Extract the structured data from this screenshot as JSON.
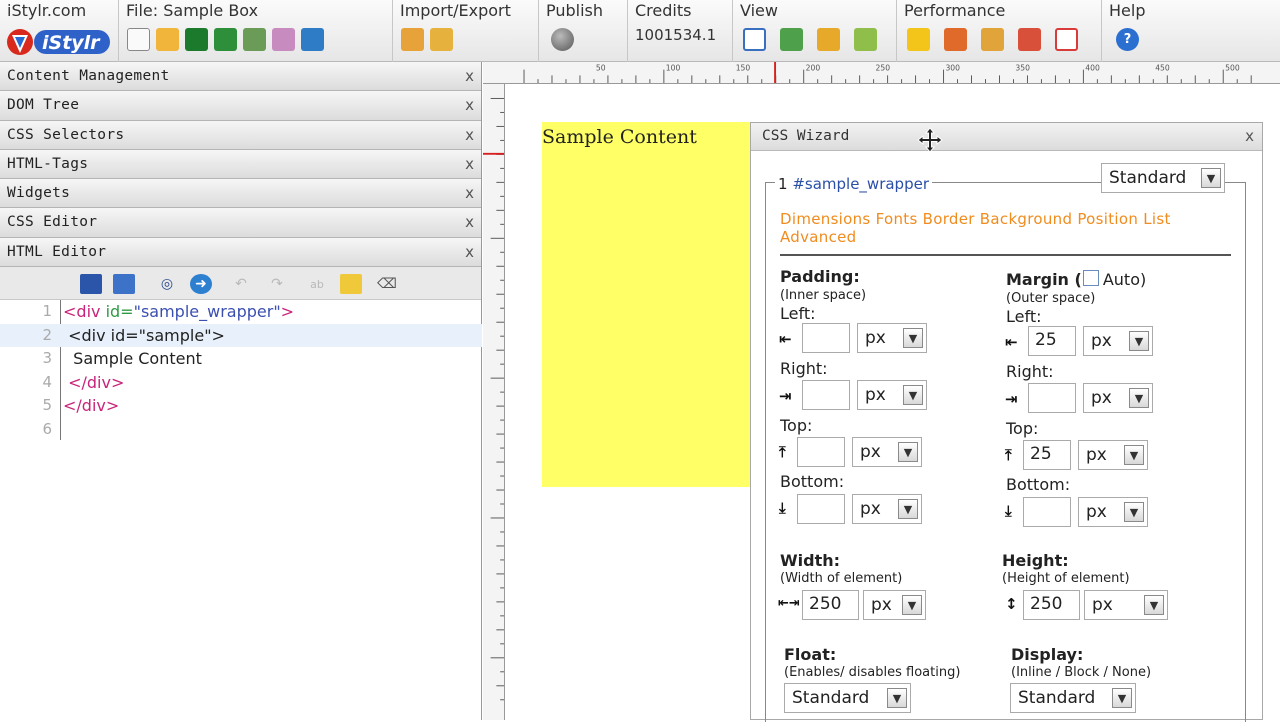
{
  "toolbar": {
    "site": "iStylr.com",
    "logo_text": "iStylr",
    "file_label": "File: Sample Box",
    "import_export": "Import/Export",
    "publish": "Publish",
    "credits_label": "Credits",
    "credits_value": "1001534.1",
    "view": "View",
    "performance": "Performance",
    "help": "Help",
    "help_icon": "?"
  },
  "panels": [
    {
      "label": "Content Management"
    },
    {
      "label": "DOM Tree"
    },
    {
      "label": "CSS Selectors"
    },
    {
      "label": "HTML-Tags"
    },
    {
      "label": "Widgets"
    },
    {
      "label": "CSS Editor"
    },
    {
      "label": "HTML Editor"
    }
  ],
  "close_glyph": "x",
  "editor": {
    "lines": [
      {
        "n": "1",
        "indent": "",
        "open": "<div ",
        "attr": "id=",
        "val": "\"sample_wrapper\"",
        "close": ">"
      },
      {
        "n": "2",
        "text": " <div id=\"sample\">"
      },
      {
        "n": "3",
        "text": "  Sample Content"
      },
      {
        "n": "4",
        "indent": " ",
        "tag": "</div>"
      },
      {
        "n": "5",
        "indent": "",
        "tag": "</div>"
      },
      {
        "n": "6",
        "text": ""
      }
    ]
  },
  "ruler": {
    "h_labels": [
      "50",
      "100",
      "150",
      "200",
      "250",
      "300",
      "350",
      "400",
      "450",
      "500"
    ]
  },
  "canvas": {
    "sample_text": "Sample Content"
  },
  "wizard": {
    "title": "CSS Wizard",
    "selector_num": "1",
    "selector": "#sample_wrapper",
    "mode": "Standard",
    "tabs_line1": "Dimensions Fonts Border Background Position List",
    "tabs_line2": "Advanced",
    "padding": {
      "title": "Padding:",
      "sub": "(Inner space)",
      "left_label": "Left:",
      "left_value": "",
      "left_unit": "px",
      "right_label": "Right:",
      "right_value": "",
      "right_unit": "px",
      "top_label": "Top:",
      "top_value": "",
      "top_unit": "px",
      "bottom_label": "Bottom:",
      "bottom_value": "",
      "bottom_unit": "px"
    },
    "margin": {
      "title": "Margin (",
      "auto": "Auto)",
      "sub": "(Outer space)",
      "left_label": "Left:",
      "left_value": "25",
      "left_unit": "px",
      "right_label": "Right:",
      "right_value": "",
      "right_unit": "px",
      "top_label": "Top:",
      "top_value": "25",
      "top_unit": "px",
      "bottom_label": "Bottom:",
      "bottom_value": "",
      "bottom_unit": "px"
    },
    "width": {
      "title": "Width:",
      "sub": "(Width of element)",
      "value": "250",
      "unit": "px"
    },
    "height": {
      "title": "Height:",
      "sub": "(Height of element)",
      "value": "250",
      "unit": "px"
    },
    "float": {
      "title": "Float:",
      "sub": "(Enables/ disables floating)",
      "value": "Standard"
    },
    "display": {
      "title": "Display:",
      "sub": "(Inline / Block / None)",
      "value": "Standard"
    }
  }
}
